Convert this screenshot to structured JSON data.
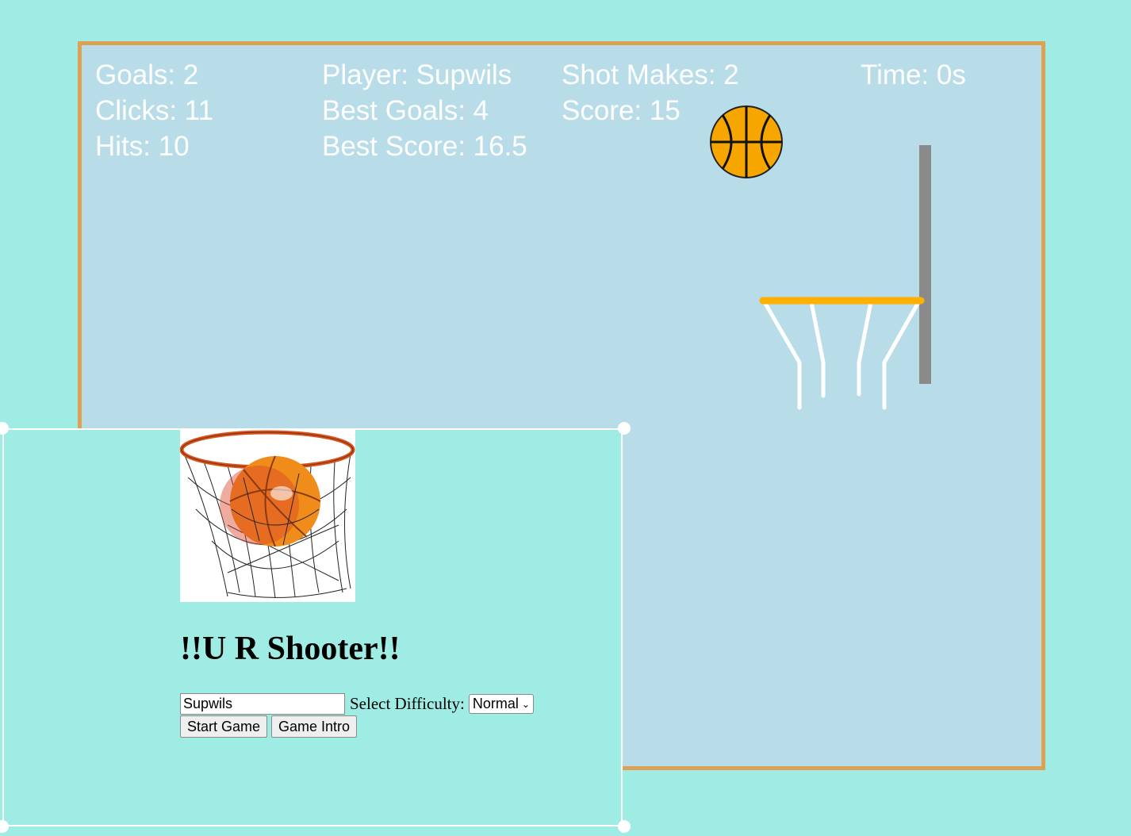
{
  "scoreboard": {
    "goals": "Goals: 2",
    "clicks": "Clicks: 11",
    "hits": "Hits: 10",
    "player": "Player: Supwils",
    "best_goals": "Best Goals: 4",
    "best_score": "Best Score: 16.5",
    "shot_makes": "Shot Makes: 2",
    "score": "Score: 15",
    "time": "Time: 0s"
  },
  "colors": {
    "page_background": "#9eece3",
    "court_background": "#b8dde9",
    "court_border": "#dca152",
    "ball": "#f7a600",
    "rim": "#ffb000",
    "backboard": "#8a8a8a",
    "net": "#ffffff"
  },
  "overlay": {
    "logo_icon": "basketball-hoop-logo",
    "title": "!!U R Shooter!!",
    "name_input_value": "Supwils",
    "difficulty_label": "Select Difficulty:",
    "difficulty_selected": "Normal",
    "start_button": "Start Game",
    "intro_button": "Game Intro"
  }
}
